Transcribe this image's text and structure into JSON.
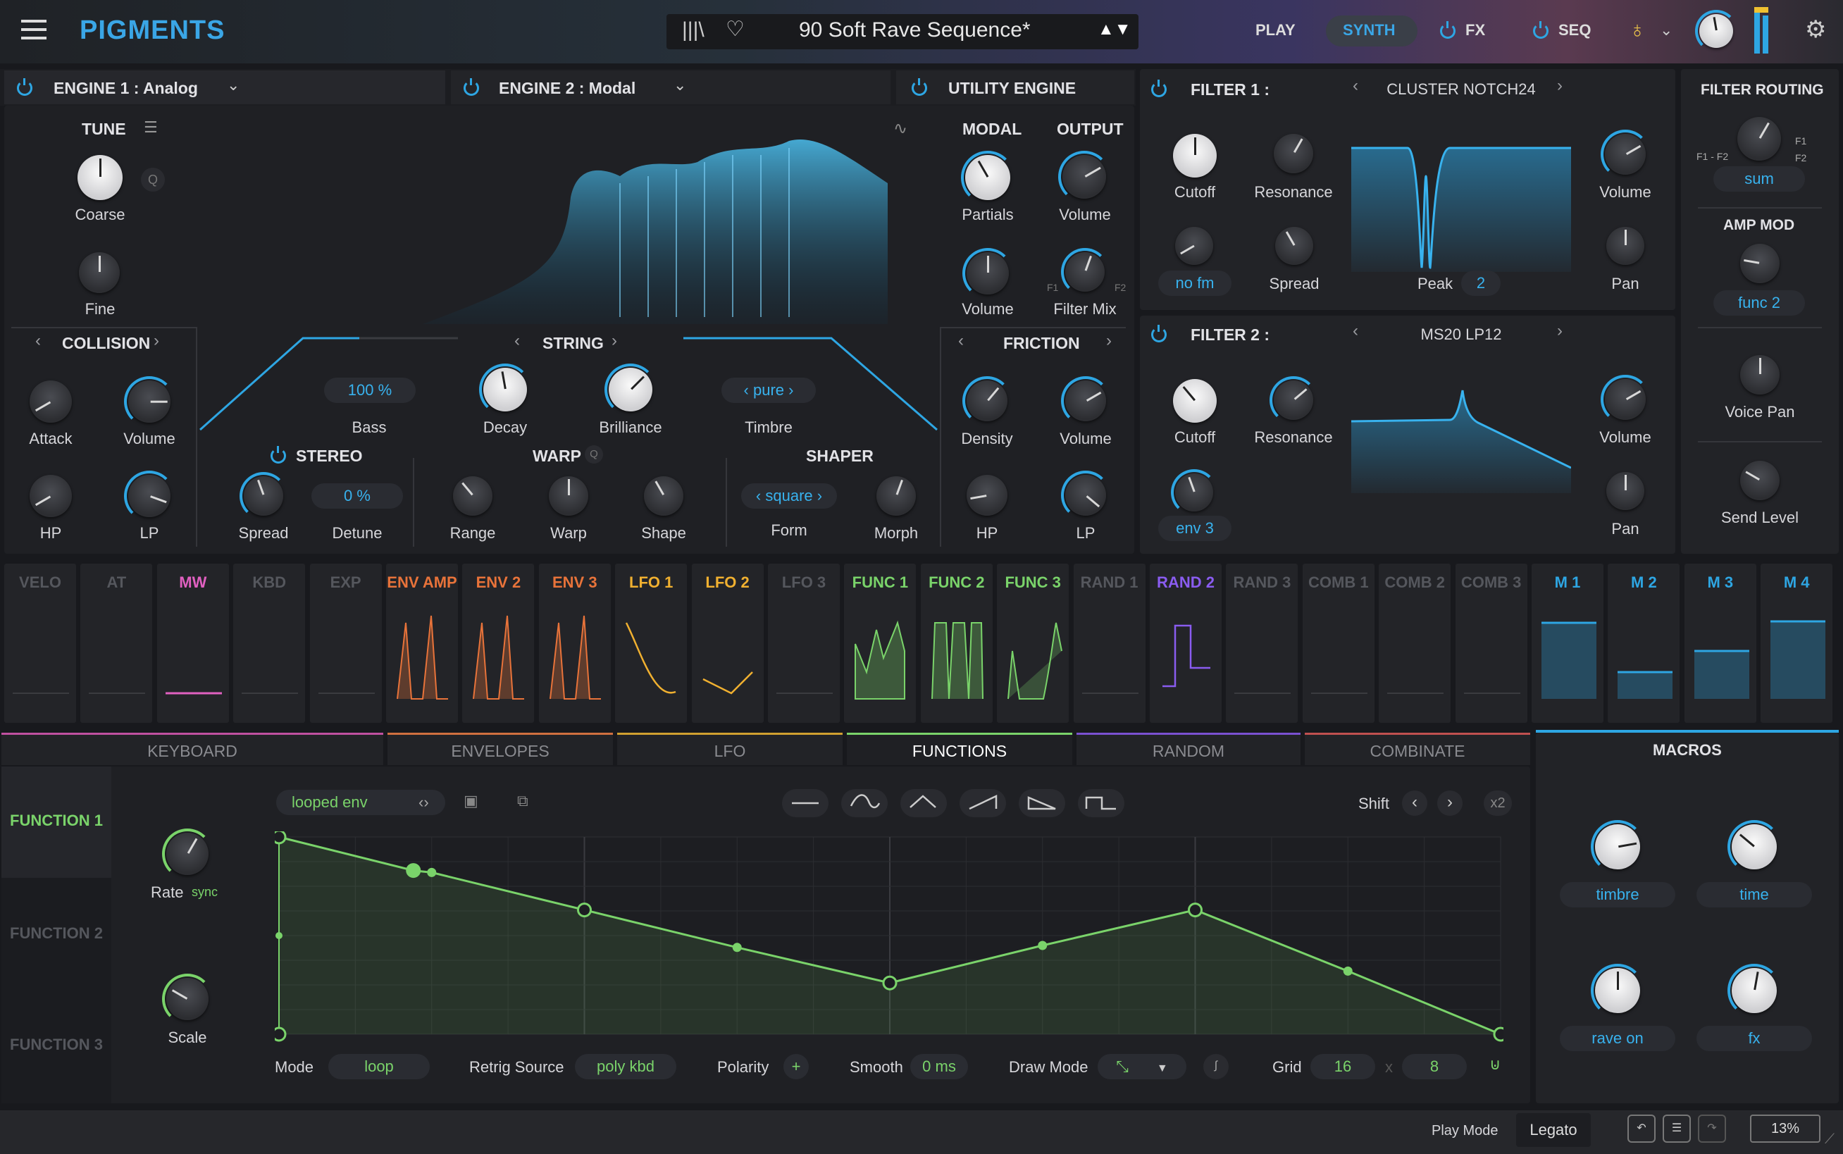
{
  "header": {
    "brand": "PIGMENTS",
    "preset": "90 Soft Rave Sequence*",
    "play": "PLAY",
    "synth": "SYNTH",
    "fx": "FX",
    "seq": "SEQ"
  },
  "engine1": {
    "title": "ENGINE 1 : Analog",
    "tune": "TUNE",
    "coarse": "Coarse",
    "fine": "Fine",
    "q": "Q"
  },
  "engine2": {
    "title": "ENGINE 2 : Modal"
  },
  "utility": {
    "title": "UTILITY ENGINE",
    "modal": "MODAL",
    "output": "OUTPUT",
    "partials": "Partials",
    "volume": "Volume",
    "volume2": "Volume",
    "filter_mix": "Filter Mix",
    "f1": "F1",
    "f2": "F2"
  },
  "collision": {
    "title": "COLLISION",
    "attack": "Attack",
    "volume": "Volume",
    "hp": "HP",
    "lp": "LP"
  },
  "string": {
    "title": "STRING",
    "bass_val": "100 %",
    "bass": "Bass",
    "decay": "Decay",
    "brilliance": "Brilliance",
    "timbre_val": "pure",
    "timbre": "Timbre"
  },
  "stereo": {
    "title": "STEREO",
    "spread": "Spread",
    "detune_val": "0 %",
    "detune": "Detune"
  },
  "warp": {
    "title": "WARP",
    "range": "Range",
    "warp": "Warp",
    "shape": "Shape",
    "q": "Q"
  },
  "shaper": {
    "title": "SHAPER",
    "form_val": "square",
    "form": "Form",
    "morph": "Morph"
  },
  "friction": {
    "title": "FRICTION",
    "density": "Density",
    "volume": "Volume",
    "hp": "HP",
    "lp": "LP"
  },
  "filter1": {
    "title": "FILTER 1 :",
    "type": "CLUSTER NOTCH24",
    "cutoff": "Cutoff",
    "resonance": "Resonance",
    "volume": "Volume",
    "fm_val": "no fm",
    "spread": "Spread",
    "peak": "Peak",
    "peak_val": "2",
    "pan": "Pan"
  },
  "filter2": {
    "title": "FILTER 2 :",
    "type": "MS20 LP12",
    "cutoff": "Cutoff",
    "resonance": "Resonance",
    "volume": "Volume",
    "mod_val": "env 3",
    "pan": "Pan"
  },
  "routing": {
    "title": "FILTER ROUTING",
    "f1f2": "F1 - F2",
    "f1": "F1",
    "f2": "F2",
    "sum": "sum",
    "amp_mod": "AMP MOD",
    "amp_val": "func 2",
    "voice_pan": "Voice Pan",
    "send_level": "Send Level"
  },
  "mod_sources": [
    "VELO",
    "AT",
    "MW",
    "KBD",
    "EXP",
    "ENV AMP",
    "ENV 2",
    "ENV 3",
    "LFO 1",
    "LFO 2",
    "LFO 3",
    "FUNC 1",
    "FUNC 2",
    "FUNC 3",
    "RAND 1",
    "RAND 2",
    "RAND 3",
    "COMB 1",
    "COMB 2",
    "COMB 3",
    "M 1",
    "M 2",
    "M 3",
    "M 4"
  ],
  "tabs": [
    "KEYBOARD",
    "ENVELOPES",
    "LFO",
    "FUNCTIONS",
    "RANDOM",
    "COMBINATE"
  ],
  "functions": {
    "f1": "FUNCTION 1",
    "f2": "FUNCTION 2",
    "f3": "FUNCTION 3",
    "rate": "Rate",
    "sync": "sync",
    "scale": "Scale",
    "preset": "looped env",
    "shift": "Shift",
    "x2": "x2",
    "mode": "Mode",
    "mode_val": "loop",
    "retrig": "Retrig Source",
    "retrig_val": "poly kbd",
    "polarity": "Polarity",
    "polarity_val": "+",
    "smooth": "Smooth",
    "smooth_val": "0 ms",
    "draw_mode": "Draw Mode",
    "grid": "Grid",
    "grid_x": "16",
    "grid_y": "8",
    "x": "x"
  },
  "function_curve": {
    "x": [
      0,
      0.11,
      0.125,
      0.25,
      0.375,
      0.5,
      0.625,
      0.75,
      0.875,
      1
    ],
    "y": [
      1,
      0.83,
      0.82,
      0.63,
      0.44,
      0.26,
      0.45,
      0.63,
      0.32,
      0
    ]
  },
  "macros": {
    "title": "MACROS",
    "m1": "timbre",
    "m2": "time",
    "m3": "rave on",
    "m4": "fx"
  },
  "footer": {
    "play_mode": "Play Mode",
    "legato": "Legato",
    "cpu": "13%"
  },
  "colors": {
    "accent": "#2ea6e3",
    "env": "#e8733a",
    "lfo": "#f0b030",
    "func": "#7ad36a",
    "rand": "#8a5cf0",
    "mw": "#e060c0",
    "macro": "#38b2ee"
  }
}
